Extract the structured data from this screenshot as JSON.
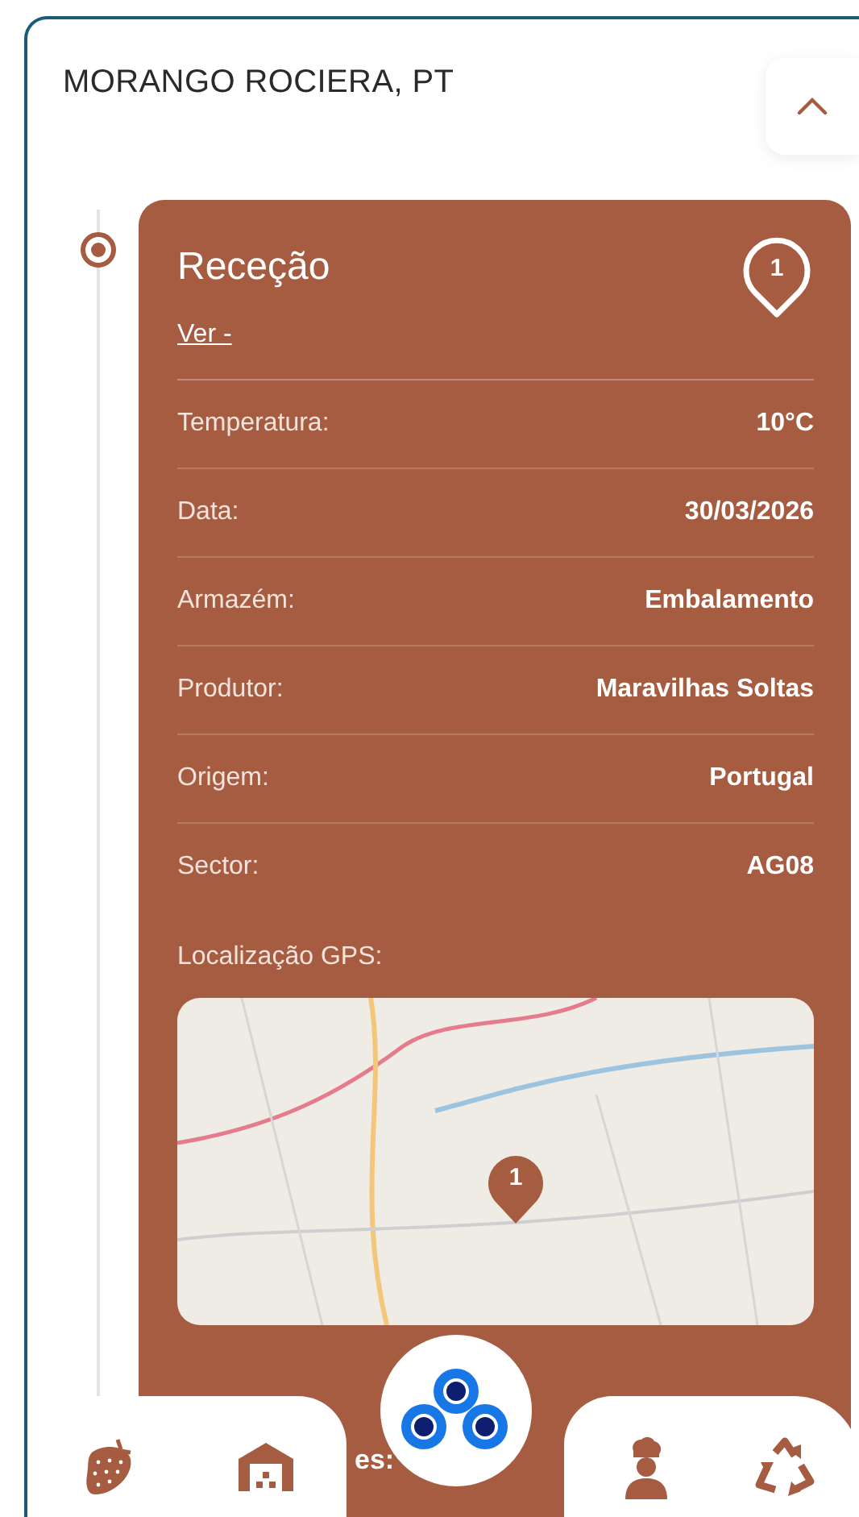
{
  "header": {
    "title": "MORANGO ROCIERA, PT",
    "expanded": true
  },
  "step": {
    "title": "Receção",
    "pin_label": "1",
    "link": "Ver -",
    "fields": [
      {
        "label": "Temperatura:",
        "value": "10°C"
      },
      {
        "label": "Data:",
        "value": "30/03/2026"
      },
      {
        "label": "Armazém:",
        "value": "Embalamento"
      },
      {
        "label": "Produtor:",
        "value": "Maravilhas Soltas"
      },
      {
        "label": "Origem:",
        "value": "Portugal"
      },
      {
        "label": "Sector:",
        "value": "AG08"
      }
    ],
    "gps_label": "Localização GPS:",
    "map_marker_label": "1",
    "partial_label": "es:"
  },
  "nav": [
    {
      "kind": "strawberry"
    },
    {
      "kind": "warehouse"
    },
    {
      "kind": "logo"
    },
    {
      "kind": "chef"
    },
    {
      "kind": "recycle"
    }
  ]
}
